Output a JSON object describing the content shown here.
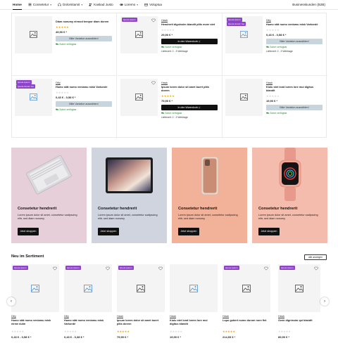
{
  "nav": {
    "items": [
      {
        "label": "Home",
        "icon": "",
        "dropdown": false,
        "active": true
      },
      {
        "label": "Consetetur",
        "icon": "list-icon",
        "dropdown": true,
        "active": false
      },
      {
        "label": "Dolorsitamit",
        "icon": "headphones-icon",
        "dropdown": true,
        "active": false
      },
      {
        "label": "Kaskad Justo",
        "icon": "users-icon",
        "dropdown": false,
        "active": false
      },
      {
        "label": "Loremo",
        "icon": "gamepad-icon",
        "dropdown": true,
        "active": false
      },
      {
        "label": "Voluptua",
        "icon": "box-icon",
        "dropdown": false,
        "active": false
      }
    ],
    "right_label": "Businesskunden (B2B)"
  },
  "products": [
    {
      "brand": "",
      "title": "Diam nonumy eirmod tempor diam dorem",
      "stars": 5,
      "price": "49,90 € *",
      "button": "Bitte Variation auswählen!",
      "button_style": "grey",
      "stock": "Sofort verfügbar",
      "delivery": "",
      "badges": [],
      "heart": false
    },
    {
      "brand": "Hawk",
      "title": "Hendrerit dignissim blandit plits more stet",
      "stars": 0,
      "price": "29,90 € *",
      "button": "In den Warenkorb",
      "button_style": "dark",
      "stock": "Sofort verfügbar",
      "delivery": "Lieferzeit: 2 - 3 Werktage",
      "badges": [
        "Quote ipsum"
      ],
      "heart": true
    },
    {
      "brand": "Dilly",
      "title": "Humo stät numo veniamu misk Varkordé",
      "stars": 0,
      "price": "0,43 € - 0,58 € *",
      "button": "Bitte Variation auswählen!",
      "button_style": "grey",
      "stock": "Sofort verfügbar",
      "delivery": "Lieferzeit: 2 - 3 Werktage",
      "badges": [
        "Quote ipsum",
        "Quote dorum foo"
      ],
      "heart": false
    },
    {
      "brand": "Dilly",
      "title": "Humo stät numo veniamu misk Varkordé",
      "stars": 0,
      "price": "0,43 € - 0,58 € *",
      "button": "Bitte Variation auswählen!",
      "button_style": "grey",
      "stock": "Sofort verfügbar",
      "delivery": "",
      "badges": [
        "Quote ipsum",
        "Quote dorum foo"
      ],
      "heart": false
    },
    {
      "brand": "Hawk",
      "title": "Ipsum lorem dolor sit amet buert plits dorem",
      "stars": 5,
      "price": "79,90 € *",
      "button": "In den Warenkorb",
      "button_style": "dark",
      "stock": "Sofort verfügbar",
      "delivery": "Lieferzeit: 2 - 3 Werktage",
      "badges": [],
      "heart": true
    },
    {
      "brand": "Hawk",
      "title": "Kiulu stet lond lorem lore mui digitus blandit",
      "stars": 0,
      "price": "19,90 € *",
      "button": "Bitte Variation auswählen!",
      "button_style": "grey",
      "stock": "Sofort verfügbar",
      "delivery": "",
      "badges": [],
      "heart": false
    }
  ],
  "banners": [
    {
      "title": "Consetetur hendrerit",
      "desc": "Lorem ipsum dolor sit amet, consetetur sadipscing elitr, sed diam nonumy",
      "button": "Jetzt shoppen",
      "bg": "#e7cfd9",
      "device": "laptop"
    },
    {
      "title": "Consetetur hendrerit",
      "desc": "Lorem ipsum dolor sit amet, consetetur sadipscing elitr, sed diam nonumy",
      "button": "Jetzt shoppen",
      "bg": "#cfd4df",
      "device": "tablet"
    },
    {
      "title": "Consetetur hendrerit",
      "desc": "Lorem ipsum dolor sit amet, consetetur sadipscing elitr, sed diam nonumy",
      "button": "Jetzt shoppen",
      "bg": "#f2b29a",
      "device": "phone"
    },
    {
      "title": "Consetetur hendrerit",
      "desc": "Lorem ipsum dolor sit amet, consetetur sadipscing elitr, sed diam nonumy",
      "button": "Jetzt shoppen",
      "bg": "#f3bcad",
      "device": "watch"
    }
  ],
  "new_section": {
    "title": "Neu im Sortiment",
    "view_all": "alle anzeigen",
    "items": [
      {
        "brand": "Dilly",
        "title": "Humo stät numo veniamu misk eirme dulm",
        "stars": 0,
        "price": "0,43 € - 0,58 € *",
        "badge": "Quote ipsum",
        "heart": true
      },
      {
        "brand": "Dilly",
        "title": "Humo stät numo veniamu misk Varkordé",
        "stars": 0,
        "price": "0,43 € - 0,38 € *",
        "badge": "Quote ipsum",
        "heart": true
      },
      {
        "brand": "Hawk",
        "title": "Ipsum lorem dolor sit amet buert plits dorem",
        "stars": 5,
        "price": "79,90 € *",
        "badge": "Quote ipsum",
        "heart": true
      },
      {
        "brand": "Hawk",
        "title": "Kiulu stet lond lorem lore mui digitus blandit",
        "stars": 0,
        "price": "19,90 € *",
        "badge": "",
        "heart": false
      },
      {
        "brand": "Hawk",
        "title": "Lopu gubert numo dorum nore flet",
        "stars": 5,
        "price": "214,53 € *",
        "badge": "Quote ipsum",
        "heart": true
      },
      {
        "brand": "Hawk",
        "title": "Gede dignissim qui blandit",
        "stars": 0,
        "price": "89,90 € *",
        "badge": "Quote ipsum",
        "heart": true
      }
    ]
  },
  "colors": {
    "accent": "#8e44c9",
    "star": "#f0a500",
    "success": "#2e8b3a",
    "dark_button": "#111111",
    "grey_button": "#c9d5dd"
  }
}
